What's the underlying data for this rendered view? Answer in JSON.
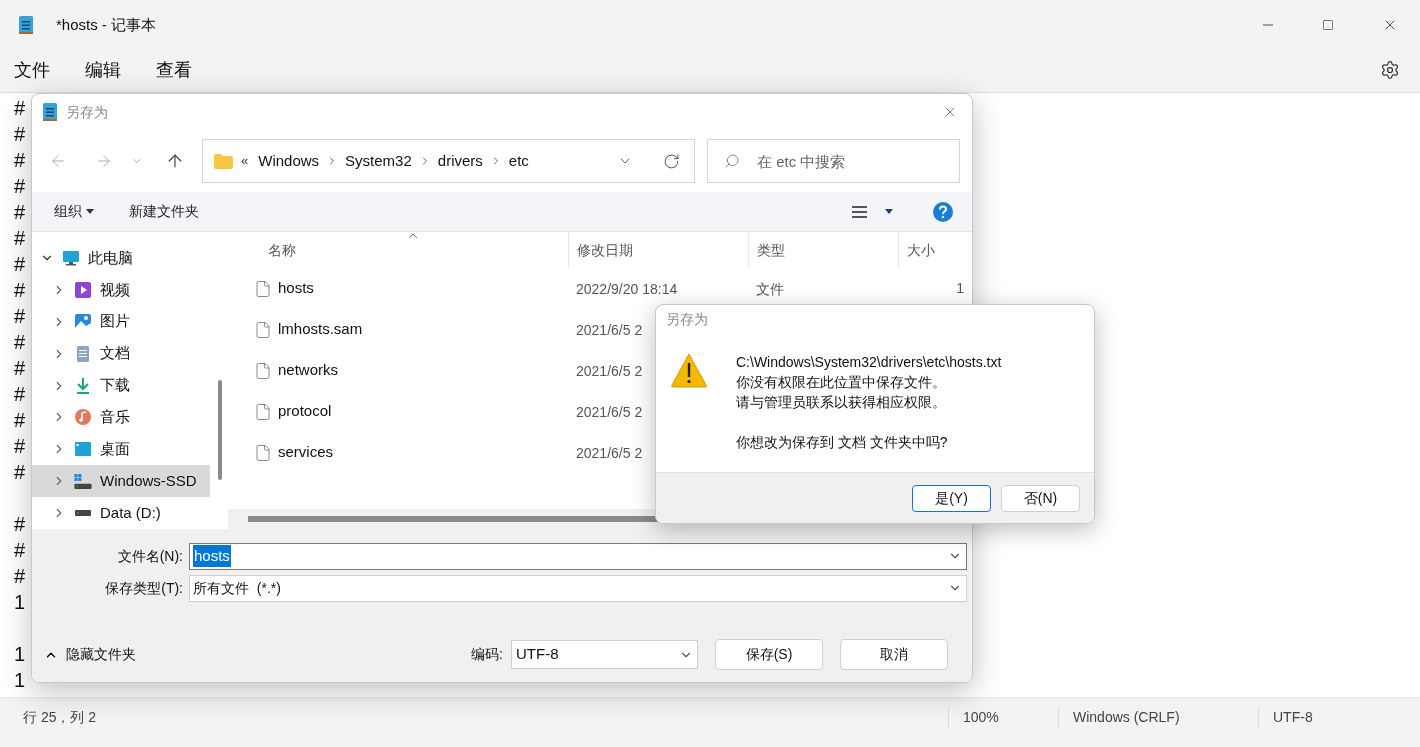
{
  "window": {
    "title": "*hosts - 记事本"
  },
  "menu": [
    "文件",
    "编辑",
    "查看"
  ],
  "editor_lines": [
    {
      "kind": "text",
      "text": "#"
    },
    {
      "kind": "text",
      "text": "#"
    },
    {
      "kind": "text",
      "text": "#"
    },
    {
      "kind": "text",
      "text": "#"
    },
    {
      "kind": "text",
      "text": "#"
    },
    {
      "kind": "text",
      "text": "#"
    },
    {
      "kind": "text",
      "text": "#"
    },
    {
      "kind": "text",
      "text": "#"
    },
    {
      "kind": "text",
      "text": "#"
    },
    {
      "kind": "text",
      "text": "#"
    },
    {
      "kind": "text",
      "text": "#"
    },
    {
      "kind": "text",
      "text": "#"
    },
    {
      "kind": "text",
      "text": "#"
    },
    {
      "kind": "text",
      "text": "#"
    },
    {
      "kind": "text",
      "text": "#"
    },
    {
      "kind": "blank"
    },
    {
      "kind": "text",
      "text": "#"
    },
    {
      "kind": "text",
      "text": "#"
    },
    {
      "kind": "text",
      "text": "#"
    },
    {
      "kind": "text",
      "text": "1"
    },
    {
      "kind": "blank"
    },
    {
      "kind": "text",
      "text": "1"
    },
    {
      "kind": "text",
      "text": "1"
    }
  ],
  "status_bar": {
    "position": "行 25，列 2",
    "zoom": "100%",
    "line_ending": "Windows (CRLF)",
    "encoding": "UTF-8"
  },
  "save_dialog": {
    "title": "另存为",
    "breadcrumb": {
      "overflow": "«",
      "parts": [
        "Windows",
        "System32",
        "drivers",
        "etc"
      ]
    },
    "search": {
      "placeholder": "在 etc 中搜索"
    },
    "toolbar": {
      "organize": "组织",
      "new_folder": "新建文件夹"
    },
    "sidebar": [
      {
        "label": "此电脑",
        "kind": "computer",
        "expanded": true,
        "selected": false,
        "children": [
          {
            "label": "视频",
            "kind": "video",
            "expanded": false,
            "selected": false
          },
          {
            "label": "图片",
            "kind": "picture",
            "expanded": false,
            "selected": false
          },
          {
            "label": "文档",
            "kind": "document",
            "expanded": false,
            "selected": false
          },
          {
            "label": "下载",
            "kind": "download",
            "expanded": false,
            "selected": false
          },
          {
            "label": "音乐",
            "kind": "music",
            "expanded": false,
            "selected": false
          },
          {
            "label": "桌面",
            "kind": "desktop",
            "expanded": false,
            "selected": false
          },
          {
            "label": "Windows-SSD",
            "kind": "system-drive",
            "expanded": false,
            "selected": true
          },
          {
            "label": "Data (D:)",
            "kind": "drive",
            "expanded": false,
            "selected": false
          }
        ]
      }
    ],
    "columns": [
      "名称",
      "修改日期",
      "类型",
      "大小"
    ],
    "files": [
      {
        "name": "hosts",
        "modified": "2022/9/20 18:14",
        "type": "文件",
        "file_size": "1"
      },
      {
        "name": "lmhosts.sam",
        "modified": "2021/6/5 2"
      },
      {
        "name": "networks",
        "modified": "2021/6/5 2"
      },
      {
        "name": "protocol",
        "modified": "2021/6/5 2"
      },
      {
        "name": "services",
        "modified": "2021/6/5 2"
      }
    ],
    "file_name": {
      "label": "文件名(N):",
      "value": "hosts"
    },
    "file_type": {
      "label": "保存类型(T):",
      "value": "所有文件  (*.*)"
    },
    "hide_folders": "隐藏文件夹",
    "encoding": {
      "label": "编码:",
      "value": "UTF-8"
    },
    "buttons": [
      "保存(S)",
      "取消"
    ]
  },
  "message_box": {
    "title": "另存为",
    "lines": [
      {
        "kind": "text",
        "text": "C:\\Windows\\System32\\drivers\\etc\\hosts.txt"
      },
      {
        "kind": "text",
        "text": "你没有权限在此位置中保存文件。"
      },
      {
        "kind": "text",
        "text": "请与管理员联系以获得相应权限。"
      },
      {
        "kind": "blank"
      },
      {
        "kind": "text",
        "text": "你想改为保存到 文档 文件夹中吗?"
      }
    ],
    "buttons": [
      {
        "label": "是(Y)",
        "default": true
      },
      {
        "label": "否(N)",
        "default": false
      }
    ]
  }
}
